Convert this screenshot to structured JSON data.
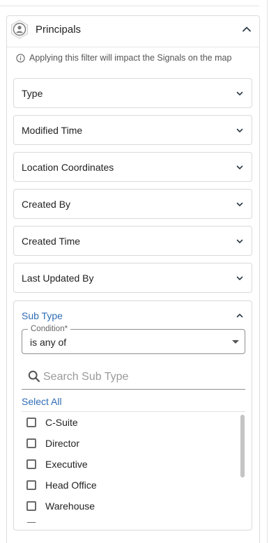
{
  "panel": {
    "title": "Principals",
    "info": "Applying this filter will impact the Signals on the map"
  },
  "filters": [
    {
      "label": "Type"
    },
    {
      "label": "Modified Time"
    },
    {
      "label": "Location Coordinates"
    },
    {
      "label": "Created By"
    },
    {
      "label": "Created Time"
    },
    {
      "label": "Last Updated By"
    }
  ],
  "subtype": {
    "title": "Sub Type",
    "condition_label": "Condition",
    "condition_required": "*",
    "condition_value": "is any of",
    "search_placeholder": "Search Sub Type",
    "select_all": "Select All",
    "items": [
      "C-Suite",
      "Director",
      "Executive",
      "Head Office",
      "Warehouse"
    ]
  },
  "colors": {
    "accent": "#2f6db5",
    "border": "#d9d9d9",
    "checkbox_border": "#6a6a6a"
  },
  "icons": {
    "panel": "person-hexagon-icon",
    "collapse": "chevron-up-icon",
    "info": "info-icon",
    "expand": "chevron-down-icon",
    "search": "search-icon"
  }
}
